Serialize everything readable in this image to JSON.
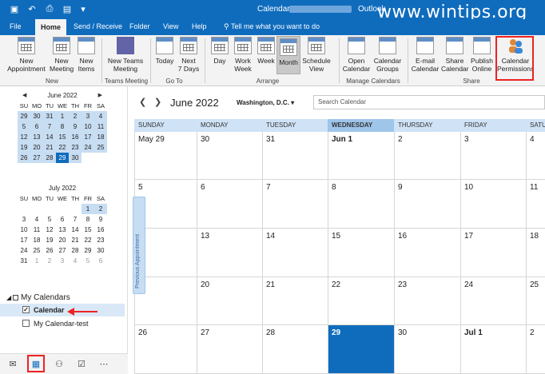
{
  "window": {
    "title": "Calendar - ",
    "app_name": "Outlook"
  },
  "watermark": "www.wintips.org",
  "menu": {
    "items": [
      "File",
      "Home",
      "Send / Receive",
      "Folder",
      "View",
      "Help"
    ],
    "tell_me": "Tell me what you want to do"
  },
  "ribbon": {
    "new_appointment": "New\nAppointment",
    "new_meeting": "New\nMeeting",
    "new_items": "New\nItems",
    "new_teams_meeting": "New Teams\nMeeting",
    "today": "Today",
    "next7": "Next\n7 Days",
    "day": "Day",
    "work_week": "Work\nWeek",
    "week": "Week",
    "month": "Month",
    "schedule_view": "Schedule\nView",
    "open_calendar": "Open\nCalendar",
    "calendar_groups": "Calendar\nGroups",
    "email_calendar": "E-mail\nCalendar",
    "share_calendar": "Share\nCalendar",
    "publish_online": "Publish\nOnline",
    "calendar_permissions": "Calendar\nPermissions",
    "groups": [
      "New",
      "Teams Meeting",
      "Go To",
      "Arrange",
      "Manage Calendars",
      "Share"
    ]
  },
  "mini_june": {
    "title": "June 2022",
    "dows": [
      "SU",
      "MO",
      "TU",
      "WE",
      "TH",
      "FR",
      "SA"
    ],
    "rows": [
      [
        "29",
        "30",
        "31",
        "1",
        "2",
        "3",
        "4"
      ],
      [
        "5",
        "6",
        "7",
        "8",
        "9",
        "10",
        "11"
      ],
      [
        "12",
        "13",
        "14",
        "15",
        "16",
        "17",
        "18"
      ],
      [
        "19",
        "20",
        "21",
        "22",
        "23",
        "24",
        "25"
      ],
      [
        "26",
        "27",
        "28",
        "29",
        "30",
        "",
        ""
      ]
    ]
  },
  "mini_july": {
    "title": "July 2022",
    "dows": [
      "SU",
      "MO",
      "TU",
      "WE",
      "TH",
      "FR",
      "SA"
    ],
    "rows": [
      [
        "",
        "",
        "",
        "",
        "",
        "1",
        "2"
      ],
      [
        "3",
        "4",
        "5",
        "6",
        "7",
        "8",
        "9"
      ],
      [
        "10",
        "11",
        "12",
        "13",
        "14",
        "15",
        "16"
      ],
      [
        "17",
        "18",
        "19",
        "20",
        "21",
        "22",
        "23"
      ],
      [
        "24",
        "25",
        "26",
        "27",
        "28",
        "29",
        "30"
      ],
      [
        "31",
        "1",
        "2",
        "3",
        "4",
        "5",
        "6"
      ]
    ]
  },
  "my_calendars": {
    "header": "My Calendars",
    "items": [
      {
        "label": "Calendar",
        "checked": true
      },
      {
        "label": "My Calendar-test",
        "checked": false
      }
    ]
  },
  "main": {
    "title": "June 2022",
    "location": "Washington, D.C.",
    "search_placeholder": "Search Calendar",
    "prev_label": "Previous Appointment",
    "days": [
      "SUNDAY",
      "MONDAY",
      "TUESDAY",
      "WEDNESDAY",
      "THURSDAY",
      "FRIDAY",
      "SATU"
    ],
    "weeks": [
      [
        "May 29",
        "30",
        "31",
        "Jun 1",
        "2",
        "3",
        "4"
      ],
      [
        "5",
        "6",
        "7",
        "8",
        "9",
        "10",
        "11"
      ],
      [
        "",
        "13",
        "14",
        "15",
        "16",
        "17",
        "18"
      ],
      [
        "",
        "20",
        "21",
        "22",
        "23",
        "24",
        "25"
      ],
      [
        "26",
        "27",
        "28",
        "29",
        "30",
        "Jul 1",
        "2"
      ]
    ]
  },
  "colors": {
    "accent": "#0f6cbd",
    "highlight": "#c7ddf2",
    "callout": "#e22222"
  }
}
